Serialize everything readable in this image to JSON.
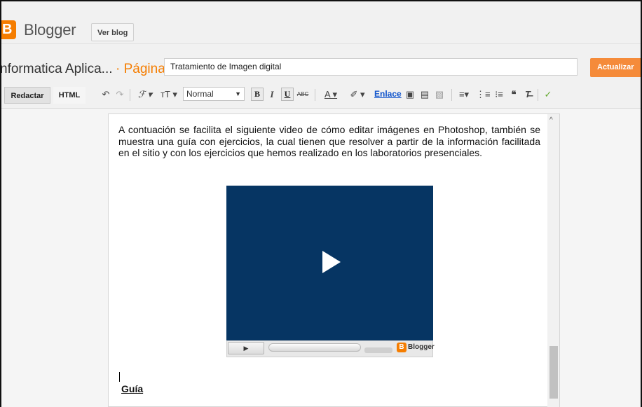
{
  "header": {
    "logo_letter": "B",
    "brand": "Blogger",
    "view_blog_label": "Ver blog"
  },
  "title_row": {
    "blog_name": "nformatica Aplica...",
    "separator_label": "· Página",
    "title_value": "Tratamiento de Imagen digital",
    "update_label": "Actualizar"
  },
  "toolbar": {
    "compose_label": "Redactar",
    "html_label": "HTML",
    "font_size_value": "Normal",
    "bold_label": "B",
    "italic_label": "I",
    "underline_label": "U",
    "strike_label": "ABC",
    "link_label": "Enlace"
  },
  "editor": {
    "paragraph": "A contuación se facilita el siguiente video de cómo editar imágenes en Photoshop, también se muestra una guía con ejercicios, la cual tienen que resolver a partir de la información facilitada en el sitio y con los  ejercicios que hemos realizado en los laboratorios presenciales.",
    "video_logo_letter": "B",
    "video_logo_text": "Blogger",
    "guide_heading": "Guía"
  },
  "colors": {
    "accent": "#f57d00",
    "video_bg": "#063563",
    "link": "#1155cc"
  }
}
